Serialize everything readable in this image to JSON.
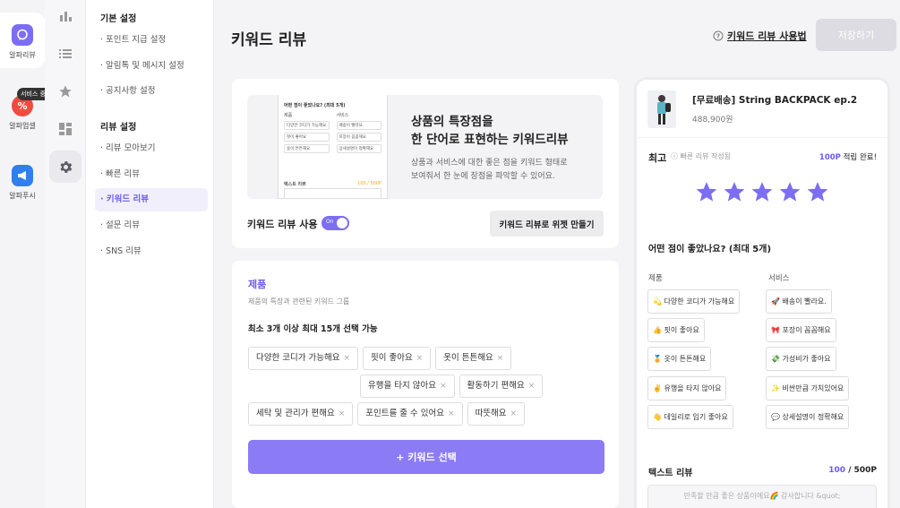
{
  "rail": {
    "apps": [
      {
        "label": "알파리뷰",
        "color": "#7c6df2",
        "icon": "chat-bubble-icon"
      },
      {
        "label": "알파업셀",
        "color": "#f04b3f",
        "icon": "percent-icon",
        "badge": "서비스 중단"
      },
      {
        "label": "알파푸시",
        "color": "#2f80ed",
        "icon": "megaphone-icon"
      }
    ]
  },
  "submenu": {
    "basic_title": "기본 설정",
    "basic_items": [
      "포인트 지급 설정",
      "알림톡 및 메시지 설정",
      "공지사항 설정"
    ],
    "review_title": "리뷰 설정",
    "review_items": [
      "리뷰 모아보기",
      "빠른 리뷰",
      "키워드 리뷰",
      "설문 리뷰",
      "SNS 리뷰"
    ]
  },
  "header": {
    "title": "키워드 리뷰",
    "guide": "키워드 리뷰 사용법",
    "save": "저장하기"
  },
  "banner": {
    "headline1": "상품의 특장점을",
    "headline2": "한 단어로 표현하는 키워드리뷰",
    "desc1": "상품과 서비스에 대한 좋은 점을 키워드 형태로",
    "desc2": "보여줘서 한 눈에 장점을 파악할 수 있어요.",
    "mini_title": "어떤 점이 좋았나요? (최대 5개)",
    "mini_col1": "제품",
    "mini_col2": "서비스",
    "mini_chips_left": [
      "다양한 코디가 가능해요",
      "핏이 좋아요",
      "옷이 튼튼해요"
    ],
    "mini_chips_right": [
      "배송이 빨라요.",
      "포장이 꼼꼼해요",
      "상세설명이 정확해요"
    ],
    "mini_text": "텍스트 리뷰",
    "mini_count": "100 / 500P"
  },
  "toggle": {
    "label": "키워드 리뷰 사용",
    "state": "On",
    "widget": "키워드 리뷰로 위젯 만들기"
  },
  "product_section": {
    "title": "제품",
    "desc": "제품의 특장과 관련된 키워드 그룹",
    "rule": "최소 3개 이상 최대 15개 선택 가능",
    "keywords": [
      "다양한 코디가 가능해요",
      "핏이 좋아요",
      "옷이 튼튼해요",
      "유행을 타지 않아요",
      "활동하기 편해요",
      "세탁 및 관리가 편해요",
      "포인트를 줄 수 있어요",
      "따뜻해요"
    ],
    "remove_glyph": "×",
    "select_button": "+ 키워드 선택"
  },
  "preview": {
    "product_name": "[무료배송] String BACKPACK ep.2",
    "price": "488,900원",
    "best": "최고",
    "best_hint": "빠른 리뷰 작성됨",
    "reward_points": "100P",
    "reward_text": "적립 완료!",
    "rating": 5,
    "question": "어떤 점이 좋았나요? (최대 5개)",
    "col_product": "제품",
    "col_service": "서비스",
    "product_chips": [
      "💫 다양한 코디가 가능해요",
      "👍 핏이 좋아요",
      "🏅 옷이 튼튼해요",
      "✌️ 유행을 타지 않아요",
      "👋 데일리로 입기 좋아요"
    ],
    "service_chips": [
      "🚀 배송이 빨라요.",
      "🎀 포장이 꼼꼼해요",
      "💸 가성비가 좋아요",
      "✨ 비싼만큼 가치있어요",
      "💬 상세설명이 정확해요"
    ],
    "text_review": "텍스트 리뷰",
    "text_count": "100",
    "text_max": "/ 500P",
    "text_placeholder": "만족할 만큼 좋은 상품이에요🌈 감사합니다 &quot;"
  },
  "colors": {
    "accent": "#7c6df2",
    "star": "#7c6df2"
  }
}
